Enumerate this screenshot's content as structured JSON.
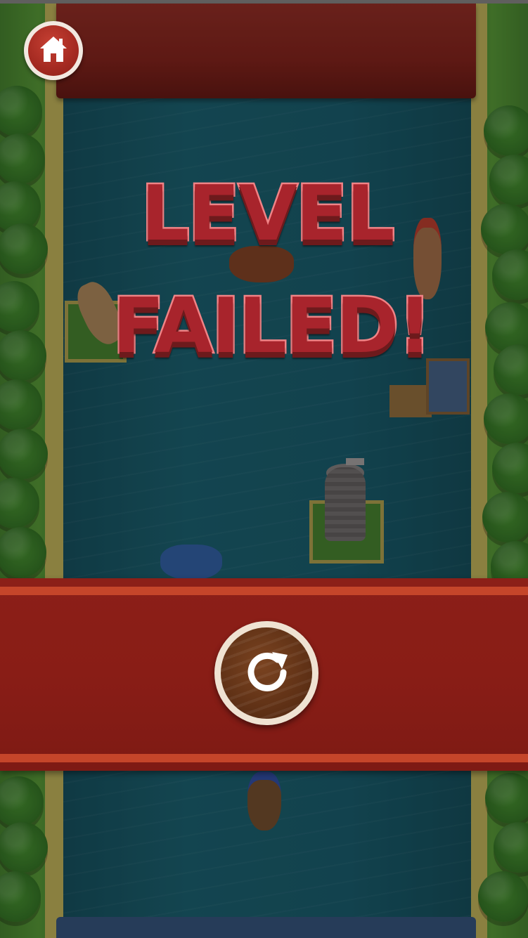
{
  "title": {
    "line1": "LEVEL",
    "line2": "FAILED!"
  },
  "buttons": {
    "home_icon": "home-icon",
    "retry_icon": "retry-icon"
  },
  "colors": {
    "title_fill": "#a8242c",
    "title_outline": "#f08386",
    "banner": "#891d16",
    "banner_stripe": "#c5452a",
    "river": "#135c6b",
    "grass": "#4f9433",
    "home_button": "#a42a21",
    "retry_button": "#5e3015"
  }
}
